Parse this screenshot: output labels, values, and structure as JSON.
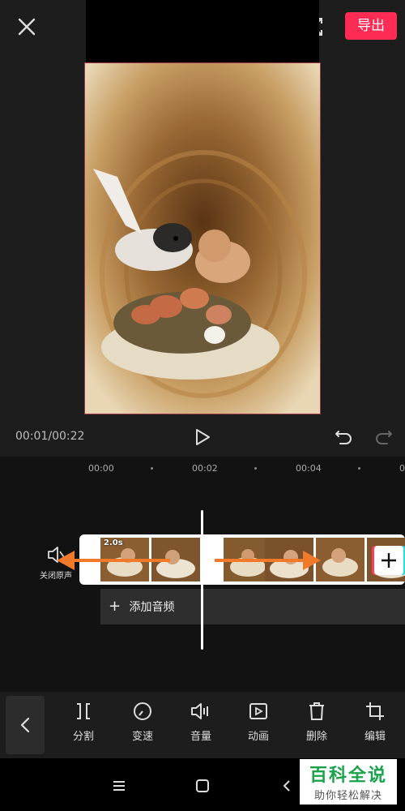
{
  "topbar": {
    "export_label": "导出"
  },
  "playback": {
    "time": "00:01/00:22"
  },
  "timeline": {
    "ruler": [
      "00:00",
      "00:02",
      "00:04",
      "0"
    ],
    "mute_label": "关闭原声",
    "clip_duration": "2.0s",
    "add_audio_label": "添加音频"
  },
  "toolbar": {
    "tools": [
      {
        "label": "分割",
        "icon": "split-icon"
      },
      {
        "label": "变速",
        "icon": "speed-icon"
      },
      {
        "label": "音量",
        "icon": "volume-icon"
      },
      {
        "label": "动画",
        "icon": "animation-icon"
      },
      {
        "label": "删除",
        "icon": "delete-icon"
      },
      {
        "label": "编辑",
        "icon": "crop-icon"
      }
    ]
  },
  "watermark": {
    "title": "百科全说",
    "subtitle": "助你轻松解决"
  },
  "colors": {
    "accent": "#fe2c55",
    "arrow": "#f07a2a",
    "background": "#1d1d1d"
  }
}
